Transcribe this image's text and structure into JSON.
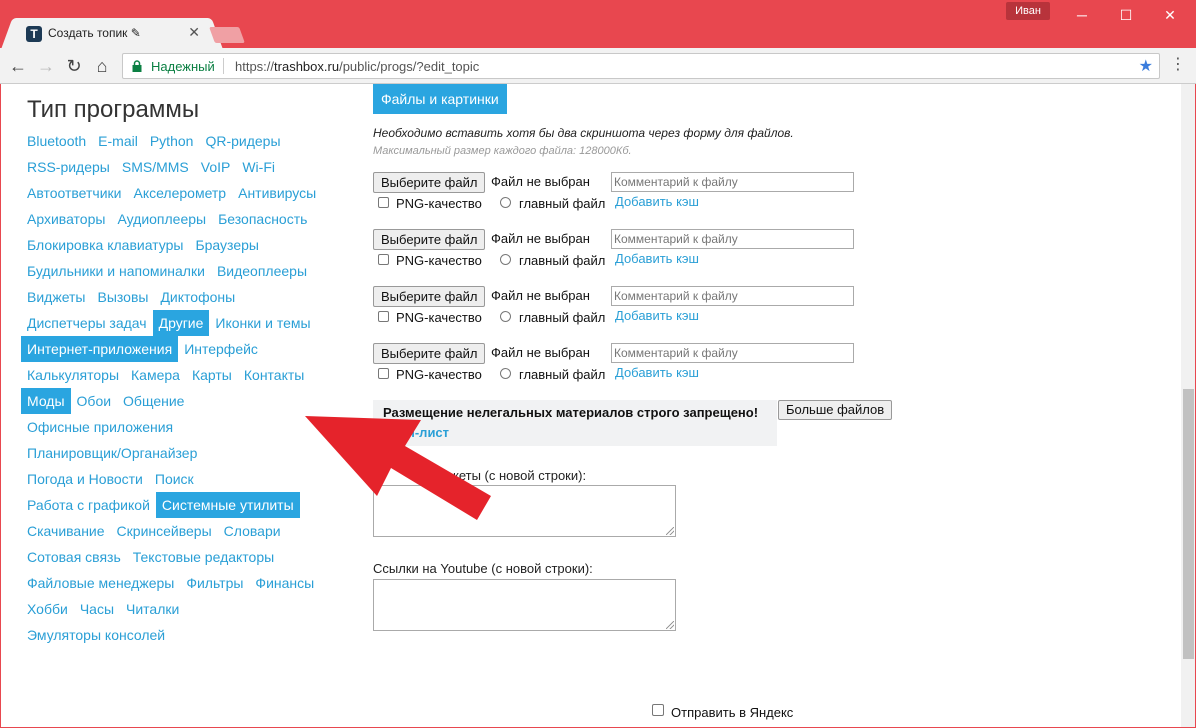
{
  "browser": {
    "tab_title": "Создать топик ✎",
    "tab_favicon_letter": "T",
    "user_name": "Иван",
    "secure_label": "Надежный",
    "url_scheme": "https://",
    "url_domain": "trashbox.ru",
    "url_path": "/public/progs/?edit_topic"
  },
  "sidebar": {
    "title": "Тип программы",
    "rows": [
      [
        {
          "label": "Bluetooth"
        },
        {
          "label": "E-mail"
        },
        {
          "label": "Python"
        },
        {
          "label": "QR-ридеры"
        }
      ],
      [
        {
          "label": "RSS-ридеры"
        },
        {
          "label": "SMS/MMS"
        },
        {
          "label": "VoIP"
        },
        {
          "label": "Wi-Fi"
        }
      ],
      [
        {
          "label": "Автоответчики"
        },
        {
          "label": "Акселерометр"
        },
        {
          "label": "Антивирусы"
        }
      ],
      [
        {
          "label": "Архиваторы"
        },
        {
          "label": "Аудиоплееры"
        },
        {
          "label": "Безопасность"
        }
      ],
      [
        {
          "label": "Блокировка клавиатуры"
        },
        {
          "label": "Браузеры"
        }
      ],
      [
        {
          "label": "Будильники и напоминалки"
        },
        {
          "label": "Видеоплееры"
        }
      ],
      [
        {
          "label": "Виджеты"
        },
        {
          "label": "Вызовы"
        },
        {
          "label": "Диктофоны"
        }
      ],
      [
        {
          "label": "Диспетчеры задач"
        },
        {
          "label": "Другие",
          "active": true
        },
        {
          "label": "Иконки и темы"
        }
      ],
      [
        {
          "label": "Интернет-приложения",
          "active": true
        },
        {
          "label": "Интерфейс"
        }
      ],
      [
        {
          "label": "Калькуляторы"
        },
        {
          "label": "Камера"
        },
        {
          "label": "Карты"
        },
        {
          "label": "Контакты"
        }
      ],
      [
        {
          "label": "Моды",
          "active": true
        },
        {
          "label": "Обои"
        },
        {
          "label": "Общение"
        }
      ],
      [
        {
          "label": "Офисные приложения"
        }
      ],
      [
        {
          "label": "Планировщик/Органайзер"
        }
      ],
      [
        {
          "label": "Погода и Новости"
        },
        {
          "label": "Поиск"
        }
      ],
      [
        {
          "label": "Работа с графикой"
        },
        {
          "label": "Системные утилиты",
          "active": true
        }
      ],
      [
        {
          "label": "Скачивание"
        },
        {
          "label": "Скринсейверы"
        },
        {
          "label": "Словари"
        }
      ],
      [
        {
          "label": "Сотовая связь"
        },
        {
          "label": "Текстовые редакторы"
        }
      ],
      [
        {
          "label": "Файловые менеджеры"
        },
        {
          "label": "Фильтры"
        },
        {
          "label": "Финансы"
        }
      ],
      [
        {
          "label": "Хобби"
        },
        {
          "label": "Часы"
        },
        {
          "label": "Читалки"
        }
      ],
      [
        {
          "label": "Эмуляторы консолей"
        }
      ]
    ]
  },
  "files": {
    "section_title": "Файлы и картинки",
    "note_required": "Необходимо вставить хотя бы два скриншота через форму для файлов.",
    "note_max_size": "Максимальный размер каждого файла: 128000Кб.",
    "choose_label": "Выберите файл",
    "no_file_label": "Файл не выбран",
    "comment_placeholder": "Комментарий к файлу",
    "png_label": "PNG-качество",
    "main_file_label": "главный файл",
    "add_cache_label": "Добавить кэш",
    "more_files_label": "Больше файлов",
    "warning_text": "Размещение нелегальных материалов строго запрещено!",
    "warning_link": "п-лист"
  },
  "form": {
    "packages_label_visible": "кеты (с новой строки):",
    "youtube_label": "Ссылки на Youtube (с новой строки):",
    "yandex_label": "Отправить в Яндекс"
  },
  "colors": {
    "accent": "#2aa5e0",
    "browser_frame": "#e8474f",
    "arrow": "#e5232b"
  }
}
